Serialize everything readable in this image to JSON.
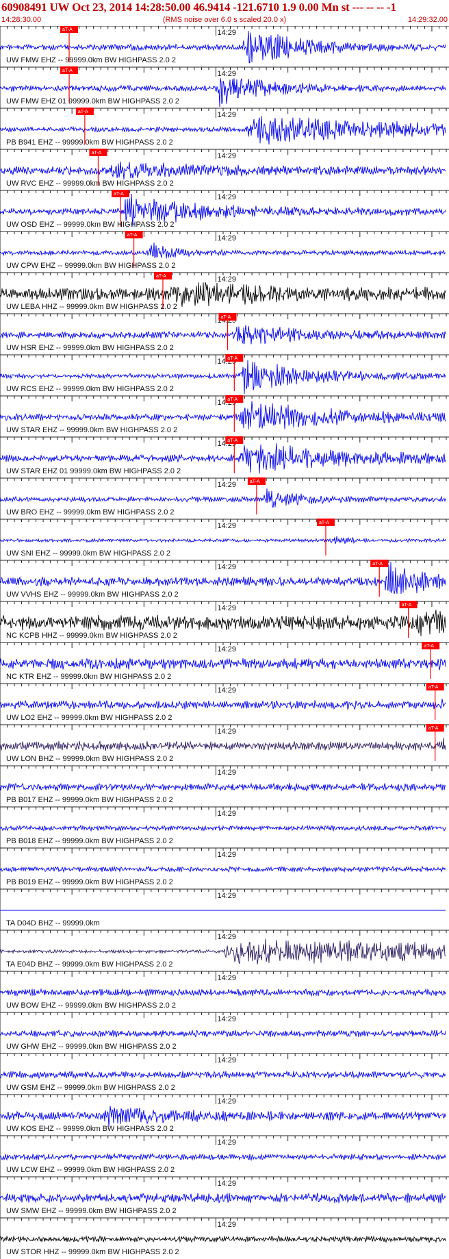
{
  "header": {
    "title": "60908491 UW Oct 23, 2014 14:28:50.00   46.9414 -121.6710  1.9 0.00 Mn st --- -- --   -1",
    "start_time": "14:28:30.00",
    "scale_note": "(RMS noise over 6.0 s scaled 20.0 x)",
    "end_time": "14:29:32.00"
  },
  "colors": {
    "header_text": "#c00000",
    "pick": "#ff0000",
    "separator": "#222222"
  },
  "chart_data": {
    "type": "line",
    "title": "60908491 UW Oct 23, 2014 14:28:50.00   46.9414 -121.6710  1.9 0.00 Mn st --- -- --   -1",
    "xlabel": "",
    "ylabel": "",
    "x_range": [
      "14:28:30.00",
      "14:29:32.00"
    ],
    "minute_label": "14:29",
    "pick_label": "aT-A",
    "traces": [
      {
        "label": "UW FMW EHZ -- 99999.0km BW  HIGHPASS  2.0  2",
        "color": "#0000ee",
        "pick": 0.155,
        "onset": 0.54,
        "peak": 0.9,
        "noise": 0.14,
        "decay": 0.12
      },
      {
        "label": "UW FMW EHZ 01 99999.0km BW  HIGHPASS  2.0  2",
        "color": "#0000ee",
        "pick": 0.155,
        "onset": 0.48,
        "peak": 0.85,
        "noise": 0.14,
        "decay": 0.1
      },
      {
        "label": "PB B941 EHZ -- 99999.0km BW  HIGHPASS  2.0  2",
        "color": "#0000ee",
        "pick": 0.19,
        "onset": 0.55,
        "peak": 0.7,
        "noise": 0.12,
        "decay": 0.35
      },
      {
        "label": "UW RVC EHZ -- 99999.0km BW  HIGHPASS  2.0  2",
        "color": "#0000ee",
        "pick": 0.22,
        "onset": 0.24,
        "peak": 0.3,
        "noise": 0.2,
        "decay": 0.2
      },
      {
        "label": "UW OSD EHZ -- 99999.0km BW  HIGHPASS  2.0  2",
        "color": "#0000ee",
        "pick": 0.27,
        "onset": 0.27,
        "peak": 0.75,
        "noise": 0.16,
        "decay": 0.18
      },
      {
        "label": "UW CPW EHZ -- 99999.0km BW  HIGHPASS  2.0  2",
        "color": "#0000ee",
        "pick": 0.3,
        "onset": 0.33,
        "peak": 0.5,
        "noise": 0.12,
        "decay": 0.05
      },
      {
        "label": "UW LEBA HHZ -- 99999.0km BW  HIGHPASS  2.0  2",
        "color": "#000000",
        "pick": 0.365,
        "onset": 0.38,
        "peak": 0.45,
        "noise": 0.3,
        "decay": 0.2
      },
      {
        "label": "UW HSR EHZ -- 99999.0km BW  HIGHPASS  2.0  2",
        "color": "#0000ee",
        "pick": 0.51,
        "onset": 0.52,
        "peak": 0.45,
        "noise": 0.16,
        "decay": 0.15
      },
      {
        "label": "UW RCS EHZ -- 99999.0km BW  HIGHPASS  2.0  2",
        "color": "#0000ee",
        "pick": 0.525,
        "onset": 0.535,
        "peak": 0.75,
        "noise": 0.12,
        "decay": 0.15
      },
      {
        "label": "UW STAR EHZ -- 99999.0km BW  HIGHPASS  2.0  2",
        "color": "#0000ee",
        "pick": 0.525,
        "onset": 0.535,
        "peak": 0.7,
        "noise": 0.16,
        "decay": 0.2
      },
      {
        "label": "UW STAR EHZ 01 99999.0km BW  HIGHPASS  2.0  2",
        "color": "#0000ee",
        "pick": 0.525,
        "onset": 0.535,
        "peak": 0.75,
        "noise": 0.18,
        "decay": 0.2
      },
      {
        "label": "UW BRO EHZ -- 99999.0km BW  HIGHPASS  2.0  2",
        "color": "#0000ee",
        "pick": 0.575,
        "onset": 0.585,
        "peak": 0.45,
        "noise": 0.12,
        "decay": 0.08
      },
      {
        "label": "UW SNI EHZ -- 99999.0km BW  HIGHPASS  2.0  2",
        "color": "#0000ee",
        "pick": 0.73,
        "onset": 0.74,
        "peak": 0.15,
        "noise": 0.08,
        "decay": 0.05
      },
      {
        "label": "UW VVHS EHZ -- 99999.0km BW  HIGHPASS  2.0  2",
        "color": "#0000ee",
        "pick": 0.85,
        "onset": 0.86,
        "peak": 0.8,
        "noise": 0.22,
        "decay": 0.1
      },
      {
        "label": "NC KCPB HHZ -- 99999.0km BW  HIGHPASS  2.0  2",
        "color": "#000000",
        "pick": 0.915,
        "onset": 0.93,
        "peak": 0.5,
        "noise": 0.35,
        "decay": 0.1
      },
      {
        "label": "NC KTR EHZ -- 99999.0km BW  HIGHPASS  2.0  2",
        "color": "#0000ee",
        "pick": 0.965,
        "onset": 0.975,
        "peak": 0.5,
        "noise": 0.26,
        "decay": 0.05
      },
      {
        "label": "UW LO2 EHZ -- 99999.0km BW  HIGHPASS  2.0  2",
        "color": "#0000ee",
        "pick": 0.975,
        "onset": 0.985,
        "peak": 0.3,
        "noise": 0.2,
        "decay": 0.05
      },
      {
        "label": "UW LON BHZ -- 99999.0km BW  HIGHPASS  2.0  2",
        "color": "#2a1a5e",
        "pick": 0.975,
        "onset": 0.985,
        "peak": 0.3,
        "noise": 0.22,
        "decay": 0.05
      },
      {
        "label": "PB B017 EHZ -- 99999.0km BW  HIGHPASS  2.0  2",
        "color": "#0000ee",
        "pick": null,
        "onset": null,
        "peak": 0,
        "noise": 0.18,
        "decay": 0.1
      },
      {
        "label": "PB B018 EHZ -- 99999.0km BW  HIGHPASS  2.0  2",
        "color": "#0000ee",
        "pick": null,
        "onset": null,
        "peak": 0,
        "noise": 0.12,
        "decay": 0.1
      },
      {
        "label": "PB B019 EHZ -- 99999.0km BW  HIGHPASS  2.0  2",
        "color": "#0000ee",
        "pick": null,
        "onset": null,
        "peak": 0,
        "noise": 0.12,
        "decay": 0.1
      },
      {
        "label": "TA D04D BHZ -- 99999.0km",
        "color": "#0000ee",
        "pick": null,
        "onset": null,
        "peak": 0,
        "noise": 0,
        "decay": 0.1
      },
      {
        "label": "TA E04D BHZ -- 99999.0km BW  HIGHPASS  2.0  2",
        "color": "#2a1a5e",
        "pick": null,
        "onset": 0.5,
        "peak": 0.6,
        "noise": 0.08,
        "decay": 0.9
      },
      {
        "label": "UW BOW EHZ -- 99999.0km BW  HIGHPASS  2.0  2",
        "color": "#0000ee",
        "pick": null,
        "onset": null,
        "peak": 0,
        "noise": 0.16,
        "decay": 0.1
      },
      {
        "label": "UW GHW EHZ -- 99999.0km BW  HIGHPASS  2.0  2",
        "color": "#0000ee",
        "pick": null,
        "onset": null,
        "peak": 0,
        "noise": 0.16,
        "decay": 0.1
      },
      {
        "label": "UW GSM EHZ -- 99999.0km BW  HIGHPASS  2.0  2",
        "color": "#0000ee",
        "pick": null,
        "onset": null,
        "peak": 0,
        "noise": 0.16,
        "decay": 0.1
      },
      {
        "label": "UW KOS EHZ -- 99999.0km BW  HIGHPASS  2.0  2",
        "color": "#0000ee",
        "pick": null,
        "onset": 0.22,
        "peak": 0.4,
        "noise": 0.2,
        "decay": 0.15
      },
      {
        "label": "UW LCW EHZ -- 99999.0km BW  HIGHPASS  2.0  2",
        "color": "#0000ee",
        "pick": null,
        "onset": null,
        "peak": 0,
        "noise": 0.14,
        "decay": 0.1
      },
      {
        "label": "UW SMW EHZ -- 99999.0km BW  HIGHPASS  2.0  2",
        "color": "#0000ee",
        "pick": null,
        "onset": null,
        "peak": 0,
        "noise": 0.24,
        "decay": 0.1
      },
      {
        "label": "UW STOR HHZ -- 99999.0km BW  HIGHPASS  2.0  2",
        "color": "#000000",
        "pick": null,
        "onset": null,
        "peak": 0,
        "noise": 0.14,
        "decay": 0.1
      }
    ]
  }
}
